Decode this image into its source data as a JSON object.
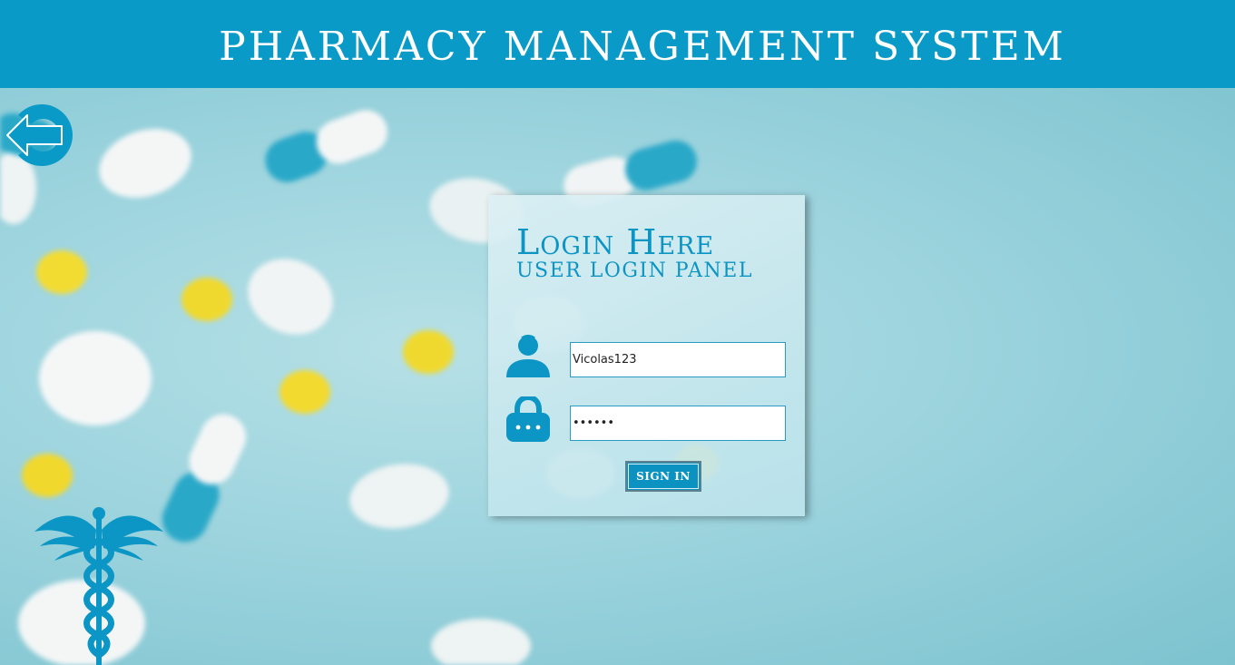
{
  "app": {
    "title": "PHARMACY MANAGEMENT SYSTEM"
  },
  "login": {
    "title": "Login Here",
    "subtitle": "USER LOGIN PANEL",
    "username_value": "Vicolas123",
    "password_value": "••••••",
    "signin_label": "SIGN IN"
  },
  "icons": {
    "back": "back-arrow-icon",
    "user": "user-icon",
    "lock": "lock-icon",
    "logo": "caduceus-icon"
  },
  "colors": {
    "brand": "#0a9ac8",
    "accent": "#0c95c4",
    "background": "#9dd4de"
  }
}
